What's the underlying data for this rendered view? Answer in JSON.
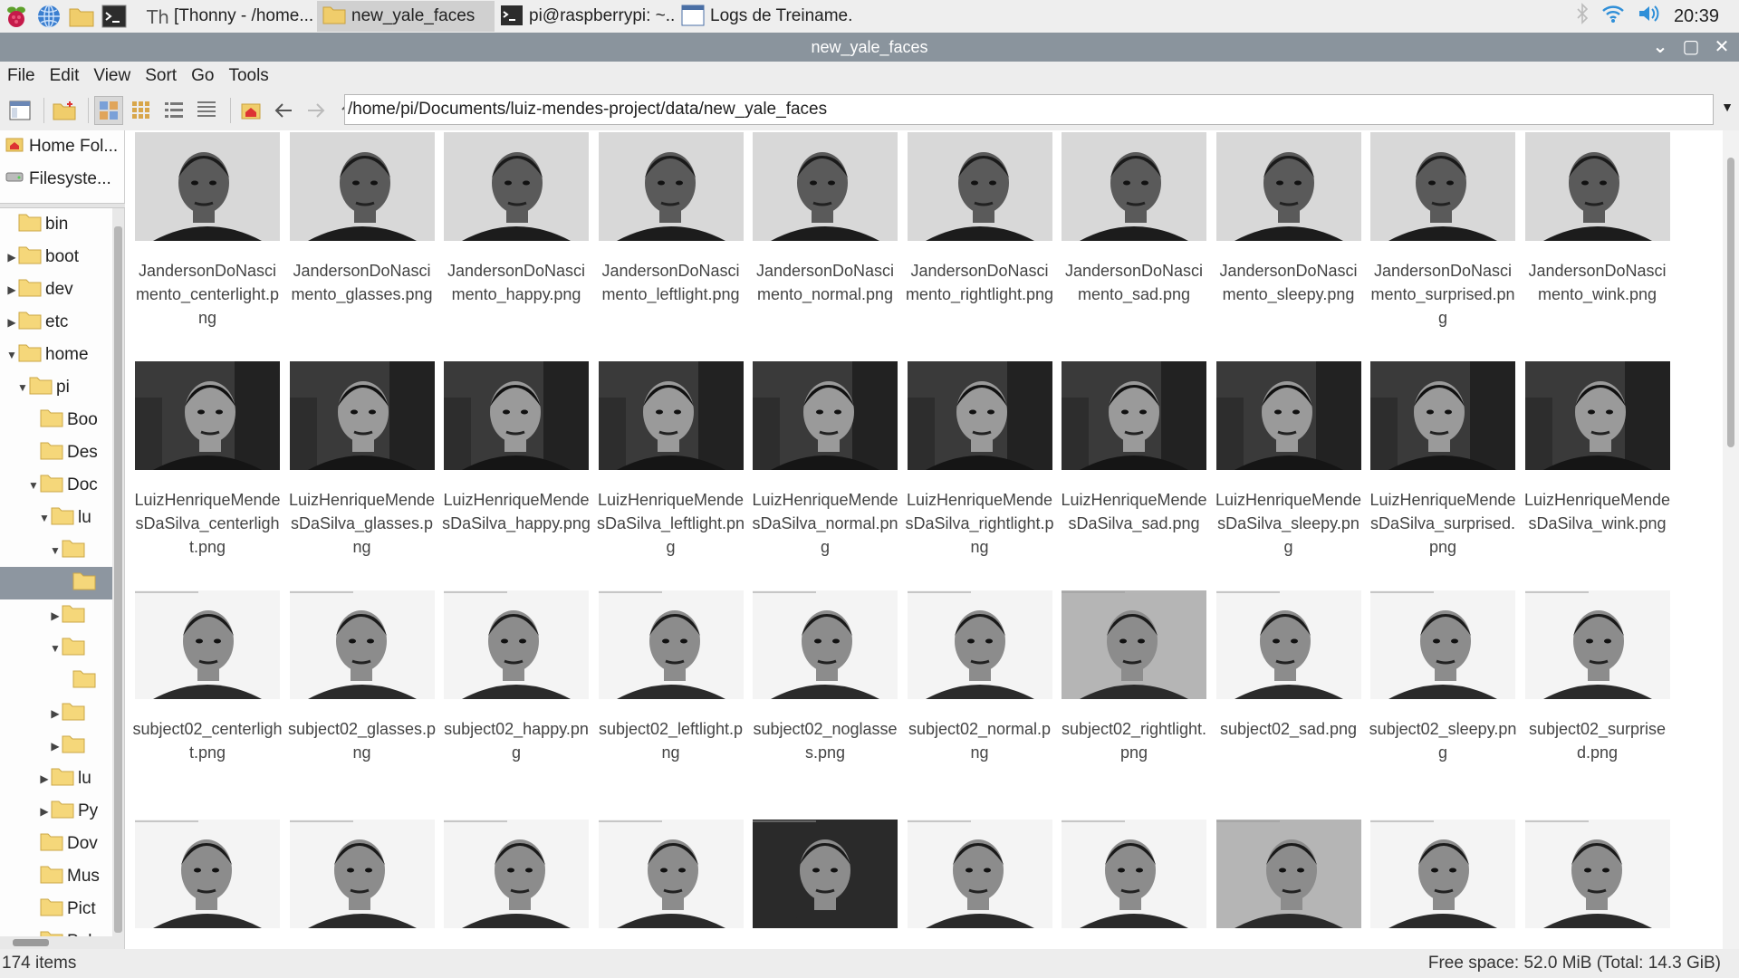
{
  "taskbar": {
    "tasks": [
      {
        "label": "[Thonny  -  /home..."
      },
      {
        "label": "new_yale_faces"
      },
      {
        "label": "pi@raspberrypi: ~..."
      },
      {
        "label": "Logs de Treiname..."
      }
    ],
    "clock": "20:39"
  },
  "window": {
    "title": "new_yale_faces"
  },
  "menu": {
    "file": "File",
    "edit": "Edit",
    "view": "View",
    "sort": "Sort",
    "go": "Go",
    "tools": "Tools"
  },
  "location": {
    "path": "/home/pi/Documents/luiz-mendes-project/data/new_yale_faces"
  },
  "places": [
    {
      "label": "Home Fol..."
    },
    {
      "label": "Filesyste..."
    }
  ],
  "tree": [
    {
      "label": "bin",
      "depth": 0,
      "exp": ""
    },
    {
      "label": "boot",
      "depth": 0,
      "exp": "▶"
    },
    {
      "label": "dev",
      "depth": 0,
      "exp": "▶"
    },
    {
      "label": "etc",
      "depth": 0,
      "exp": "▶"
    },
    {
      "label": "home",
      "depth": 0,
      "exp": "▼"
    },
    {
      "label": "pi",
      "depth": 1,
      "exp": "▼"
    },
    {
      "label": "Boo",
      "depth": 2,
      "exp": ""
    },
    {
      "label": "Des",
      "depth": 2,
      "exp": ""
    },
    {
      "label": "Doc",
      "depth": 2,
      "exp": "▼"
    },
    {
      "label": "lu",
      "depth": 3,
      "exp": "▼"
    },
    {
      "label": "",
      "depth": 4,
      "exp": "▼"
    },
    {
      "label": "",
      "depth": 5,
      "exp": "",
      "selected": true
    },
    {
      "label": "",
      "depth": 4,
      "exp": "▶"
    },
    {
      "label": "",
      "depth": 4,
      "exp": "▼"
    },
    {
      "label": "",
      "depth": 5,
      "exp": ""
    },
    {
      "label": "",
      "depth": 4,
      "exp": "▶"
    },
    {
      "label": "",
      "depth": 4,
      "exp": "▶"
    },
    {
      "label": "lu",
      "depth": 3,
      "exp": "▶"
    },
    {
      "label": "Py",
      "depth": 3,
      "exp": "▶"
    },
    {
      "label": "Dov",
      "depth": 2,
      "exp": ""
    },
    {
      "label": "Mus",
      "depth": 2,
      "exp": ""
    },
    {
      "label": "Pict",
      "depth": 2,
      "exp": ""
    },
    {
      "label": "Pub",
      "depth": 2,
      "exp": ""
    }
  ],
  "files": [
    {
      "name": "JandersonDoNascimento_centerlight.png",
      "style": "dark"
    },
    {
      "name": "JandersonDoNascimento_glasses.png",
      "style": "dark"
    },
    {
      "name": "JandersonDoNascimento_happy.png",
      "style": "dark"
    },
    {
      "name": "JandersonDoNascimento_leftlight.png",
      "style": "dark"
    },
    {
      "name": "JandersonDoNascimento_normal.png",
      "style": "dark"
    },
    {
      "name": "JandersonDoNascimento_rightlight.png",
      "style": "dark"
    },
    {
      "name": "JandersonDoNascimento_sad.png",
      "style": "dark"
    },
    {
      "name": "JandersonDoNascimento_sleepy.png",
      "style": "dark"
    },
    {
      "name": "JandersonDoNascimento_surprised.png",
      "style": "dark"
    },
    {
      "name": "JandersonDoNascimento_wink.png",
      "style": "dark"
    },
    {
      "name": "LuizHenriqueMendesDaSilva_centerlight.png",
      "style": "indoor"
    },
    {
      "name": "LuizHenriqueMendesDaSilva_glasses.png",
      "style": "indoor"
    },
    {
      "name": "LuizHenriqueMendesDaSilva_happy.png",
      "style": "indoor"
    },
    {
      "name": "LuizHenriqueMendesDaSilva_leftlight.png",
      "style": "indoor"
    },
    {
      "name": "LuizHenriqueMendesDaSilva_normal.png",
      "style": "indoor"
    },
    {
      "name": "LuizHenriqueMendesDaSilva_rightlight.png",
      "style": "indoor"
    },
    {
      "name": "LuizHenriqueMendesDaSilva_sad.png",
      "style": "indoor"
    },
    {
      "name": "LuizHenriqueMendesDaSilva_sleepy.png",
      "style": "indoor"
    },
    {
      "name": "LuizHenriqueMendesDaSilva_surprised.png",
      "style": "indoor"
    },
    {
      "name": "LuizHenriqueMendesDaSilva_wink.png",
      "style": "indoor"
    },
    {
      "name": "subject02_centerlight.png",
      "style": "yale"
    },
    {
      "name": "subject02_glasses.png",
      "style": "yale"
    },
    {
      "name": "subject02_happy.png",
      "style": "yale"
    },
    {
      "name": "subject02_leftlight.png",
      "style": "yale"
    },
    {
      "name": "subject02_noglasses.png",
      "style": "yale"
    },
    {
      "name": "subject02_normal.png",
      "style": "yale"
    },
    {
      "name": "subject02_rightlight.png",
      "style": "yale-grey"
    },
    {
      "name": "subject02_sad.png",
      "style": "yale"
    },
    {
      "name": "subject02_sleepy.png",
      "style": "yale"
    },
    {
      "name": "subject02_surprised.png",
      "style": "yale"
    },
    {
      "name": "",
      "style": "yale"
    },
    {
      "name": "",
      "style": "yale"
    },
    {
      "name": "",
      "style": "yale"
    },
    {
      "name": "",
      "style": "yale"
    },
    {
      "name": "",
      "style": "yale-dark"
    },
    {
      "name": "",
      "style": "yale"
    },
    {
      "name": "",
      "style": "yale"
    },
    {
      "name": "",
      "style": "yale-grey"
    },
    {
      "name": "",
      "style": "yale"
    },
    {
      "name": "",
      "style": "yale"
    }
  ],
  "status": {
    "items": "174 items",
    "free": "Free space: 52.0 MiB (Total: 14.3 GiB)"
  },
  "colors": {
    "titlebar": "#8a949d",
    "selection": "#8d96a0",
    "folder": "#f5d77a"
  }
}
